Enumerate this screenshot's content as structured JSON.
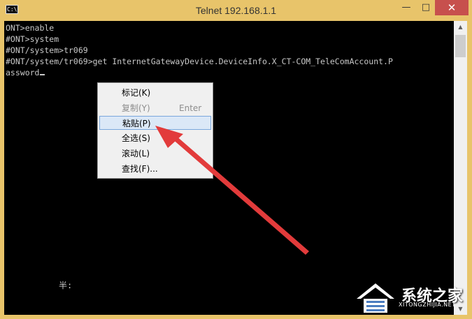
{
  "window": {
    "title": "Telnet 192.168.1.1",
    "icon_label": "C:\\",
    "controls": {
      "minimize": "—",
      "maximize": "□",
      "close": "✕"
    }
  },
  "console": {
    "lines": [
      "ONT>enable",
      "#ONT>system",
      "#ONT/system>tr069",
      "#ONT/system/tr069>get InternetGatewayDevice.DeviceInfo.X_CT-COM_TeleComAccount.P",
      "assword"
    ],
    "ime_status": "半:"
  },
  "context_menu": {
    "items": [
      {
        "label": "标记(K)",
        "shortcut": "",
        "disabled": false,
        "highlighted": false
      },
      {
        "label": "复制(Y)",
        "shortcut": "Enter",
        "disabled": true,
        "highlighted": false
      },
      {
        "label": "粘贴(P)",
        "shortcut": "",
        "disabled": false,
        "highlighted": true
      },
      {
        "label": "全选(S)",
        "shortcut": "",
        "disabled": false,
        "highlighted": false
      },
      {
        "label": "滚动(L)",
        "shortcut": "",
        "disabled": false,
        "highlighted": false
      },
      {
        "label": "查找(F)...",
        "shortcut": "",
        "disabled": false,
        "highlighted": false
      }
    ]
  },
  "watermark": {
    "brand": "系统之家",
    "site": "XITONGZHIJIA.NET"
  },
  "colors": {
    "title_bar": "#e8c46a",
    "close_button": "#c7504d",
    "console_bg": "#000000",
    "console_text": "#c8c8c8",
    "menu_highlight": "#dbe8f7",
    "arrow": "#e23b3b"
  },
  "icons": {
    "scroll_up": "triangle-up-icon",
    "scroll_down": "triangle-down-icon",
    "annotation": "red-arrow-icon"
  }
}
